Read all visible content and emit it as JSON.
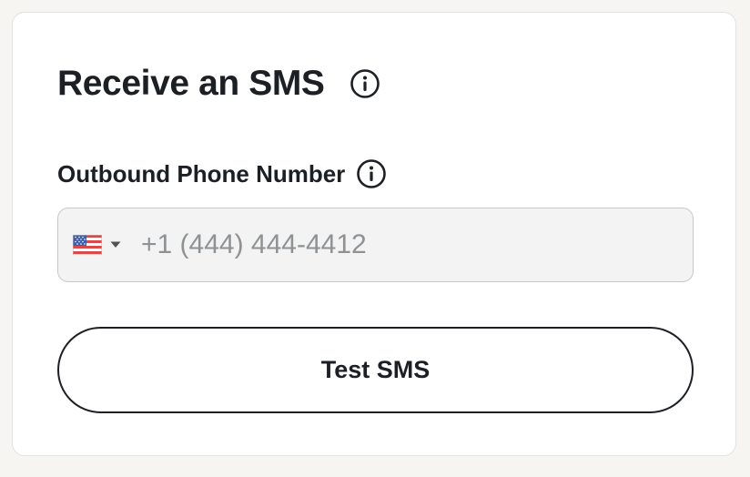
{
  "card": {
    "title": "Receive an SMS",
    "title_info_icon": "info-icon",
    "phone_label": "Outbound Phone Number",
    "phone_label_info_icon": "info-icon",
    "phone": {
      "country": "US",
      "country_flag_icon": "us-flag-icon",
      "placeholder": "+1 (444) 444-4412",
      "value": ""
    },
    "test_button_label": "Test SMS"
  },
  "colors": {
    "page_background": "#f6f5f1",
    "card_background": "#ffffff",
    "text": "#1c2024",
    "input_background": "#f2f3f2",
    "input_border": "#c7c9c8",
    "placeholder": "#8e9295"
  }
}
